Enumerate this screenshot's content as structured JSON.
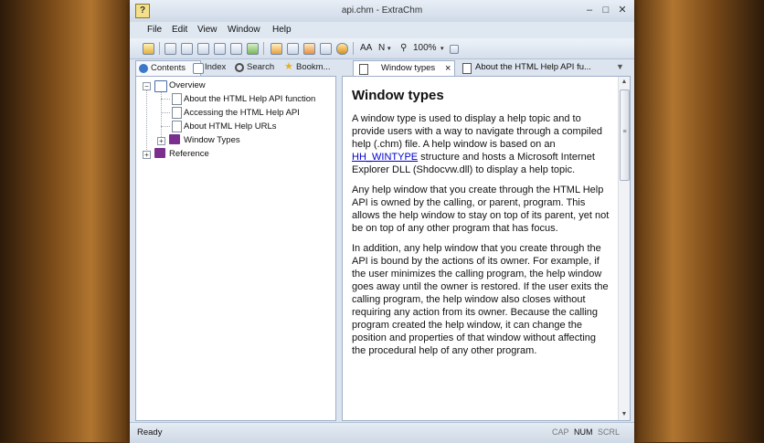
{
  "window": {
    "title": "api.chm - ExtraChm",
    "app_icon_glyph": "?",
    "buttons": {
      "minimize": "–",
      "maximize": "□",
      "close": "✕"
    }
  },
  "menu": [
    "File",
    "Edit",
    "View",
    "Window",
    "Help"
  ],
  "toolbar": {
    "font_label": "AA",
    "font_menu": "N",
    "zoom": "100%"
  },
  "left_tabs": [
    {
      "label": "Contents",
      "icon": "contents-icon",
      "color": "#3a78c8"
    },
    {
      "label": "Index",
      "icon": "index-icon",
      "color": "#6a8ab0"
    },
    {
      "label": "Search",
      "icon": "search-icon",
      "color": "#4a4a4a"
    },
    {
      "label": "Bookm...",
      "icon": "bookmark-star-icon",
      "color": "#e8b020"
    }
  ],
  "tree": {
    "overview": "Overview",
    "items": [
      "About the HTML Help API function",
      "Accessing the HTML Help API",
      "About HTML Help URLs"
    ],
    "window_types": "Window Types",
    "reference": "Reference"
  },
  "doc_tabs": [
    {
      "label": "Window types",
      "close": "×"
    },
    {
      "label": "About the HTML Help API fu..."
    }
  ],
  "doc_tabs_more": "▼",
  "content": {
    "heading": "Window types",
    "p1_before": "A window type is used to display a help topic and to provide users with a way to navigate through a compiled help (.chm) file. A help window is based on an ",
    "p1_link": "HH_WINTYPE",
    "p1_after": " structure and hosts a Microsoft Internet Explorer DLL (Shdocvw.dll) to display a help topic.",
    "p2": "Any help window that you create through the HTML Help API is owned by the calling, or parent, program. This allows the help window to stay on top of its parent, yet not be on top of any other program that has focus.",
    "p3": "In addition, any help window that you create through the API is bound by the actions of its owner. For example, if the user minimizes the calling program, the help window goes away until the owner is restored. If the user exits the calling program, the help window also closes without requiring any action from its owner. Because the calling program created the help window, it can change the position and properties of that window without affecting the procedural help of any other program."
  },
  "scroll": {
    "up": "▲",
    "grip": "≡",
    "down": "▼"
  },
  "status": {
    "text": "Ready",
    "indicators": [
      "CAP",
      "NUM",
      "SCRL"
    ]
  },
  "colors": {
    "book_purple": "#7a2f8e",
    "book_blue": "#4a6aa8",
    "link": "#0000cc"
  }
}
